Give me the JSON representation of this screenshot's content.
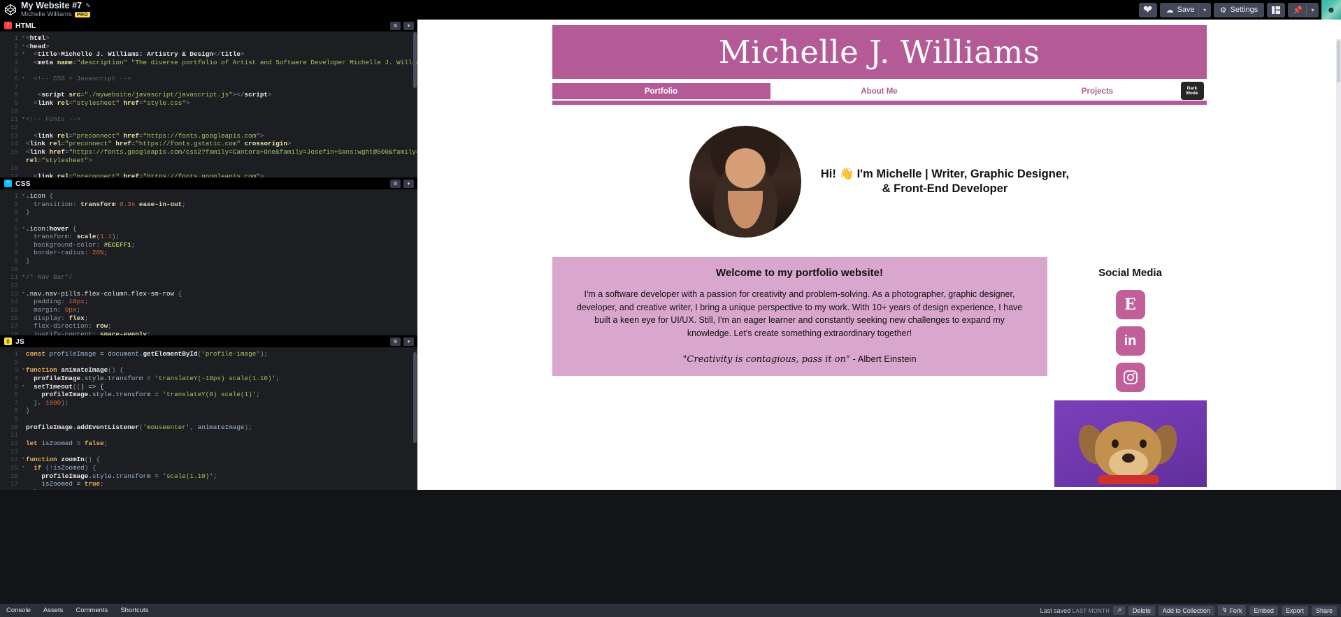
{
  "topbar": {
    "pen_title": "My Website #7",
    "author": "Michelle Williams",
    "pro_badge": "PRO",
    "edit_icon": "pencil-icon",
    "logo_icon": "codepen-logo-icon",
    "heart_icon": "heart-icon",
    "save_label": "Save",
    "save_icon": "cloud-icon",
    "save_caret": "▾",
    "settings_label": "Settings",
    "settings_icon": "gear-icon",
    "layout_icon": "layout-icon",
    "pin_icon": "pin-icon",
    "pin_caret": "▾",
    "avatar_icon": "user-avatar"
  },
  "editor": {
    "panes": [
      {
        "name": "HTML",
        "badge_color": "#ff3c41",
        "badge_glyph": "/",
        "settings_icon": "gear-icon",
        "collapse_icon": "chevron-down-icon",
        "lines": [
          {
            "n": "1",
            "fold": "▾",
            "html": "<span class=\"t-brk\">&lt;</span><span class=\"t-tag\">html</span><span class=\"t-brk\">&gt;</span>"
          },
          {
            "n": "2",
            "fold": "▾",
            "html": "<span class=\"t-brk\">&lt;</span><span class=\"t-tag\">head</span><span class=\"t-brk\">&gt;</span>"
          },
          {
            "n": "3",
            "fold": "▾",
            "html": "  <span class=\"t-brk\">&lt;</span><span class=\"t-tag\">title</span><span class=\"t-brk\">&gt;</span><span class=\"t-tag\">Michelle J. Williams: Artistry &amp; Design</span><span class=\"t-brk\">&lt;/</span><span class=\"t-tag\">title</span><span class=\"t-brk\">&gt;</span>"
          },
          {
            "n": "4",
            "fold": "",
            "html": "  <span class=\"t-brk\">&lt;</span><span class=\"t-tag\">meta</span> <span class=\"t-attr\">name</span><span class=\"t-brk\">=</span><span class=\"t-str\">\"description\"</span> <span class=\"t-str\">\"The diverse portfolio of Artist and Software Developer Michelle J. Williams.\"</span><span class=\"t-brk\">&gt;</span>"
          },
          {
            "n": "5",
            "fold": "",
            "html": ""
          },
          {
            "n": "6",
            "fold": "▾",
            "html": "  <span class=\"t-cmt\">&lt;!-- CSS + Javascript --&gt;</span>"
          },
          {
            "n": "7",
            "fold": "",
            "html": ""
          },
          {
            "n": "8",
            "fold": "",
            "html": "   <span class=\"t-brk\">&lt;</span><span class=\"t-tag\">script</span> <span class=\"t-attr\">src</span><span class=\"t-brk\">=</span><span class=\"t-str\">\"./mywebsite/javascript/javascript.js\"</span><span class=\"t-brk\">&gt;&lt;/</span><span class=\"t-tag\">script</span><span class=\"t-brk\">&gt;</span>"
          },
          {
            "n": "9",
            "fold": "",
            "html": "  <span class=\"t-brk\">&lt;</span><span class=\"t-tag\">link</span> <span class=\"t-attr\">rel</span><span class=\"t-brk\">=</span><span class=\"t-str\">\"stylesheet\"</span> <span class=\"t-attr\">href</span><span class=\"t-brk\">=</span><span class=\"t-str\">\"style.css\"</span><span class=\"t-brk\">&gt;</span>"
          },
          {
            "n": "10",
            "fold": "",
            "html": ""
          },
          {
            "n": "11",
            "fold": "▾",
            "html": "<span class=\"t-cmt\">&lt;!-- Fonts --&gt;</span>"
          },
          {
            "n": "12",
            "fold": "",
            "html": ""
          },
          {
            "n": "13",
            "fold": "",
            "html": "  <span class=\"t-brk\">&lt;</span><span class=\"t-tag\">link</span> <span class=\"t-attr\">rel</span><span class=\"t-brk\">=</span><span class=\"t-str\">\"preconnect\"</span> <span class=\"t-attr\">href</span><span class=\"t-brk\">=</span><span class=\"t-str\">\"https://fonts.googleapis.com\"</span><span class=\"t-brk\">&gt;</span>"
          },
          {
            "n": "14",
            "fold": "",
            "html": "<span class=\"t-brk\">&lt;</span><span class=\"t-tag\">link</span> <span class=\"t-attr\">rel</span><span class=\"t-brk\">=</span><span class=\"t-str\">\"preconnect\"</span> <span class=\"t-attr\">href</span><span class=\"t-brk\">=</span><span class=\"t-str\">\"https://fonts.gstatic.com\"</span> <span class=\"t-attr\">crossorigin</span><span class=\"t-brk\">&gt;</span>"
          },
          {
            "n": "15",
            "fold": "",
            "html": "<span class=\"t-brk\">&lt;</span><span class=\"t-tag\">link</span> <span class=\"t-attr\">href</span><span class=\"t-brk\">=</span><span class=\"t-str\">\"https://fonts.googleapis.com/css2?family=Cantora+One&amp;family=Josefin+Sans:wght@500&amp;family=Jost&amp;display=swap\"</span>"
          },
          {
            "n": "",
            "fold": "",
            "html": "<span class=\"t-attr\">rel</span><span class=\"t-brk\">=</span><span class=\"t-str\">\"stylesheet\"</span><span class=\"t-brk\">&gt;</span>"
          },
          {
            "n": "16",
            "fold": "",
            "html": ""
          },
          {
            "n": "17",
            "fold": "",
            "html": "  <span class=\"t-brk\">&lt;</span><span class=\"t-tag\">link</span> <span class=\"t-attr\">rel</span><span class=\"t-brk\">=</span><span class=\"t-str\">\"preconnect\"</span> <span class=\"t-attr\">href</span><span class=\"t-brk\">=</span><span class=\"t-str\">\"https://fonts.googleapis.com\"</span><span class=\"t-brk\">&gt;</span>"
          }
        ]
      },
      {
        "name": "CSS",
        "badge_color": "#0ebeff",
        "badge_glyph": "*",
        "settings_icon": "gear-icon",
        "collapse_icon": "chevron-down-icon",
        "lines": [
          {
            "n": "1",
            "fold": "▾",
            "html": "<span class=\"t-sel\">.icon</span> <span class=\"t-brk\">{</span>"
          },
          {
            "n": "2",
            "fold": "",
            "html": "  <span class=\"t-prop\">transition</span><span class=\"t-brk\">:</span> <span class=\"t-val\">transform</span> <span class=\"t-num\">0.3s</span> <span class=\"t-val\">ease-in-out</span><span class=\"t-brk\">;</span>"
          },
          {
            "n": "3",
            "fold": "",
            "html": "<span class=\"t-brk\">}</span>"
          },
          {
            "n": "4",
            "fold": "",
            "html": ""
          },
          {
            "n": "5",
            "fold": "▾",
            "html": "<span class=\"t-sel\">.icon</span><span class=\"t-pseudo\">:hover</span> <span class=\"t-brk\">{</span>"
          },
          {
            "n": "6",
            "fold": "",
            "html": "  <span class=\"t-prop\">transform</span><span class=\"t-brk\">:</span> <span class=\"t-val\">scale</span><span class=\"t-brk\">(</span><span class=\"t-num\">1.1</span><span class=\"t-brk\">);</span>"
          },
          {
            "n": "7",
            "fold": "",
            "html": "  <span class=\"t-prop\">background-color</span><span class=\"t-brk\">:</span> <span class=\"t-hex\">#ECEFF1</span><span class=\"t-brk\">;</span>"
          },
          {
            "n": "8",
            "fold": "",
            "html": "  <span class=\"t-prop\">border-radius</span><span class=\"t-brk\">:</span> <span class=\"t-num\">20%</span><span class=\"t-brk\">;</span>"
          },
          {
            "n": "9",
            "fold": "",
            "html": "<span class=\"t-brk\">}</span>"
          },
          {
            "n": "10",
            "fold": "",
            "html": ""
          },
          {
            "n": "11",
            "fold": "▾",
            "html": "<span class=\"t-cmt\">/* Nav Bar*/</span>"
          },
          {
            "n": "12",
            "fold": "",
            "html": ""
          },
          {
            "n": "13",
            "fold": "▾",
            "html": "<span class=\"t-sel\">.nav.nav-pills.flex-column.flex-sm-row</span> <span class=\"t-brk\">{</span>"
          },
          {
            "n": "14",
            "fold": "",
            "html": "  <span class=\"t-prop\">padding</span><span class=\"t-brk\">:</span> <span class=\"t-num\">10px</span><span class=\"t-brk\">;</span>"
          },
          {
            "n": "15",
            "fold": "",
            "html": "  <span class=\"t-prop\">margin</span><span class=\"t-brk\">:</span> <span class=\"t-num\">0px</span><span class=\"t-brk\">;</span>"
          },
          {
            "n": "16",
            "fold": "",
            "html": "  <span class=\"t-prop\">display</span><span class=\"t-brk\">:</span> <span class=\"t-val\">flex</span><span class=\"t-brk\">;</span>"
          },
          {
            "n": "17",
            "fold": "",
            "html": "  <span class=\"t-prop\">flex-direction</span><span class=\"t-brk\">:</span> <span class=\"t-val\">row</span><span class=\"t-brk\">;</span>"
          },
          {
            "n": "18",
            "fold": "",
            "html": "  <span class=\"t-prop\">justify-content</span><span class=\"t-brk\">:</span> <span class=\"t-val\">space-evenly</span><span class=\"t-brk\">;</span>"
          }
        ]
      },
      {
        "name": "JS",
        "badge_color": "#ffdd40",
        "badge_glyph": "()",
        "settings_icon": "gear-icon",
        "collapse_icon": "chevron-down-icon",
        "lines": [
          {
            "n": "1",
            "fold": "",
            "html": "<span class=\"t-kw\">const</span> <span class=\"t-var\">profileImage</span> <span class=\"t-op\">=</span> <span class=\"t-var\">document</span><span class=\"t-op\">.</span><span class=\"t-fn\">getElementById</span><span class=\"t-brk\">(</span><span class=\"t-str\">'profile-image'</span><span class=\"t-brk\">);</span>"
          },
          {
            "n": "2",
            "fold": "",
            "html": ""
          },
          {
            "n": "3",
            "fold": "▾",
            "html": "<span class=\"t-kw\">function</span> <span class=\"t-fn\">animateImage</span><span class=\"t-brk\">() {</span>"
          },
          {
            "n": "4",
            "fold": "",
            "html": "  <span class=\"t-fn\">profileImage</span><span class=\"t-op\">.</span><span class=\"t-var\">style</span><span class=\"t-op\">.</span><span class=\"t-var\">transform</span> <span class=\"t-op\">=</span> <span class=\"t-str\">'translateY(-10px) scale(1.10)'</span><span class=\"t-brk\">;</span>"
          },
          {
            "n": "5",
            "fold": "▾",
            "html": "  <span class=\"t-fn\">setTimeout</span><span class=\"t-brk\">((</span><span class=\"t-op\">) =&gt; {</span>"
          },
          {
            "n": "6",
            "fold": "",
            "html": "    <span class=\"t-fn\">profileImage</span><span class=\"t-op\">.</span><span class=\"t-var\">style</span><span class=\"t-op\">.</span><span class=\"t-var\">transform</span> <span class=\"t-op\">=</span> <span class=\"t-str\">'translateY(0) scale(1)'</span><span class=\"t-brk\">;</span>"
          },
          {
            "n": "7",
            "fold": "",
            "html": "  <span class=\"t-brk\">},</span> <span class=\"t-num\">1000</span><span class=\"t-brk\">);</span>"
          },
          {
            "n": "8",
            "fold": "",
            "html": "<span class=\"t-brk\">}</span>"
          },
          {
            "n": "9",
            "fold": "",
            "html": ""
          },
          {
            "n": "10",
            "fold": "",
            "html": "<span class=\"t-fn\">profileImage</span><span class=\"t-op\">.</span><span class=\"t-fn\">addEventListener</span><span class=\"t-brk\">(</span><span class=\"t-str\">'mouseenter'</span><span class=\"t-brk\">,</span> <span class=\"t-var\">animateImage</span><span class=\"t-brk\">);</span>"
          },
          {
            "n": "11",
            "fold": "",
            "html": ""
          },
          {
            "n": "12",
            "fold": "",
            "html": "<span class=\"t-kw\">let</span> <span class=\"t-var\">isZoomed</span> <span class=\"t-op\">=</span> <span class=\"t-kw\">false</span><span class=\"t-brk\">;</span>"
          },
          {
            "n": "13",
            "fold": "",
            "html": ""
          },
          {
            "n": "14",
            "fold": "▾",
            "html": "<span class=\"t-kw\">function</span> <span class=\"t-fn\">zoomIn</span><span class=\"t-brk\">() {</span>"
          },
          {
            "n": "15",
            "fold": "▾",
            "html": "  <span class=\"t-kw\">if</span> <span class=\"t-brk\">(!</span><span class=\"t-var\">isZoomed</span><span class=\"t-brk\">) {</span>"
          },
          {
            "n": "16",
            "fold": "",
            "html": "    <span class=\"t-fn\">profileImage</span><span class=\"t-op\">.</span><span class=\"t-var\">style</span><span class=\"t-op\">.</span><span class=\"t-var\">transform</span> <span class=\"t-op\">=</span> <span class=\"t-str\">'scale(1.10)'</span><span class=\"t-brk\">;</span>"
          },
          {
            "n": "17",
            "fold": "",
            "html": "    <span class=\"t-var\">isZoomed</span> <span class=\"t-op\">=</span> <span class=\"t-kw\">true</span><span class=\"t-brk\">;</span>"
          },
          {
            "n": "18",
            "fold": "",
            "html": "  <span class=\"t-brk\">}</span>"
          }
        ]
      }
    ]
  },
  "preview": {
    "hero_name": "Michelle J. Williams",
    "nav": [
      {
        "label": "Portfolio",
        "active": true
      },
      {
        "label": "About Me",
        "active": false
      },
      {
        "label": "Projects",
        "active": false
      }
    ],
    "dark_mode_line1": "Dark",
    "dark_mode_line2": "Mode",
    "profile_image_alt": "profile-photo",
    "intro_line1": "Hi! 👋 I'm Michelle | Writer, Graphic Designer,",
    "intro_line2": "& Front-End Developer",
    "welcome_title": "Welcome to my portfolio website!",
    "welcome_body": "I'm a software developer with a passion for creativity and problem-solving. As a photographer, graphic designer, developer, and creative writer, I bring a unique perspective to my work. With 10+ years of design experience, I have built a keen eye for UI/UX. Still, I'm an eager learner and constantly seeking new challenges to expand my knowledge. Let's create something extraordinary together!",
    "quote_text": "\"Creativity is contagious, pass it on\"",
    "quote_attrib": " - Albert Einstein",
    "social_title": "Social Media",
    "social_icons": [
      {
        "name": "etsy-icon",
        "glyph": "E"
      },
      {
        "name": "linkedin-icon",
        "glyph": "in"
      },
      {
        "name": "instagram-icon",
        "glyph": "▢"
      }
    ],
    "accent_color": "#b45a96",
    "card_color": "#d9a7cd",
    "dog_image_alt": "cartoon-dog-illustration"
  },
  "bottombar": {
    "tabs": [
      "Console",
      "Assets",
      "Comments",
      "Shortcuts"
    ],
    "saved_prefix": "Last saved",
    "saved_when": "LAST MONTH",
    "expand_icon": "external-link-icon",
    "buttons": [
      "Delete",
      "Add to Collection",
      "Fork",
      "Embed",
      "Export",
      "Share"
    ],
    "fork_icon": "fork-icon"
  }
}
